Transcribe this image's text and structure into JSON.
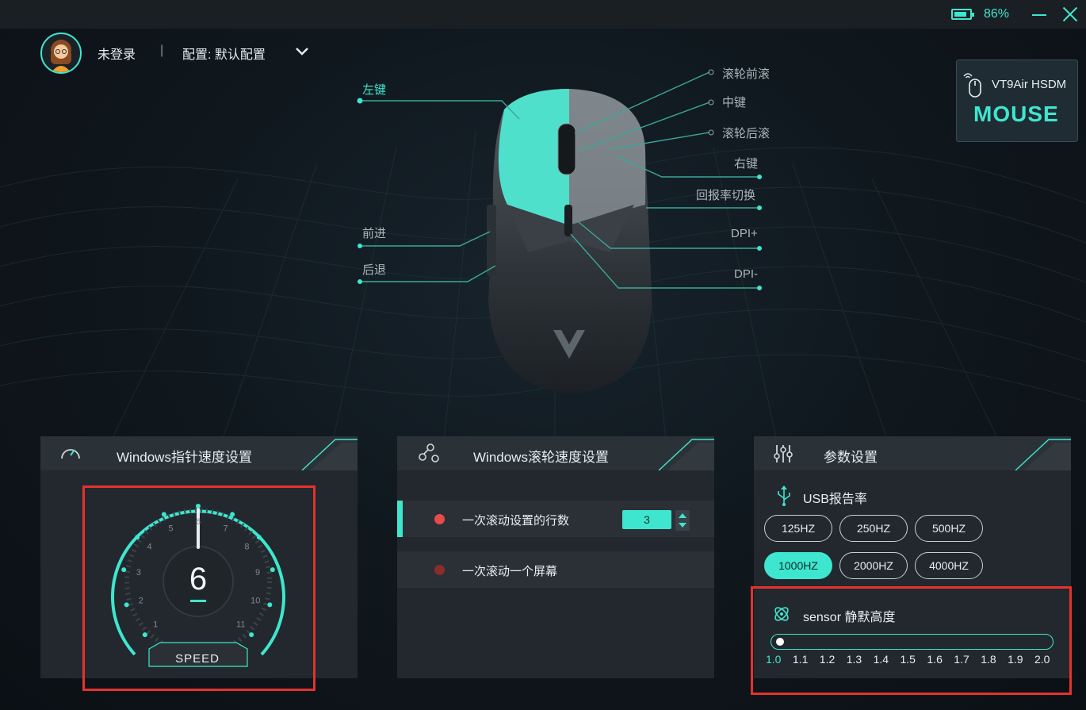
{
  "topbar": {
    "battery_text": "86%",
    "battery_level": 0.86,
    "minimize_icon": "minus-icon",
    "close_icon": "close-icon"
  },
  "header": {
    "login_text": "未登录",
    "separator": "|",
    "config_text": "配置: 默认配置",
    "dropdown_icon": "chevron-down-icon"
  },
  "mouse_labels": {
    "left_button": "左键",
    "wheel_up": "滚轮前滚",
    "middle": "中键",
    "wheel_down": "滚轮后滚",
    "right_button": "右键",
    "report_rate_switch": "回报率切换",
    "dpi_plus": "DPI+",
    "dpi_minus": "DPI-",
    "forward": "前进",
    "back": "后退"
  },
  "device": {
    "name": "VT9Air HSDM",
    "logo": "MOUSE"
  },
  "pointer_panel": {
    "title": "Windows指针速度设置",
    "icon": "speedometer-icon",
    "speed_value": "6",
    "speed_label": "SPEED",
    "dial_numbers": [
      "1",
      "2",
      "3",
      "4",
      "5",
      "6",
      "7",
      "8",
      "9",
      "10",
      "11"
    ]
  },
  "scroll_panel": {
    "title": "Windows滚轮速度设置",
    "icon": "scroll-settings-icon",
    "option_lines": "一次滚动设置的行数",
    "lines_value": "3",
    "option_screen": "一次滚动一个屏幕"
  },
  "params_panel": {
    "title": "参数设置",
    "icon": "sliders-icon",
    "usb_title": "USB报告率",
    "usb_icon": "usb-icon",
    "rates": [
      "125HZ",
      "250HZ",
      "500HZ",
      "1000HZ",
      "2000HZ",
      "4000HZ"
    ],
    "selected_rate": "1000HZ",
    "sensor_title": "sensor 静默高度",
    "sensor_icon": "sensor-icon",
    "sensor_ticks": [
      "1.0",
      "1.1",
      "1.2",
      "1.3",
      "1.4",
      "1.5",
      "1.6",
      "1.7",
      "1.8",
      "1.9",
      "2.0"
    ],
    "sensor_value": 1.0
  },
  "colors": {
    "accent": "#3ee6cf",
    "highlight_box": "#e5322d",
    "radio_active": "#e84a4a",
    "radio_inactive": "#8a2c2c"
  }
}
